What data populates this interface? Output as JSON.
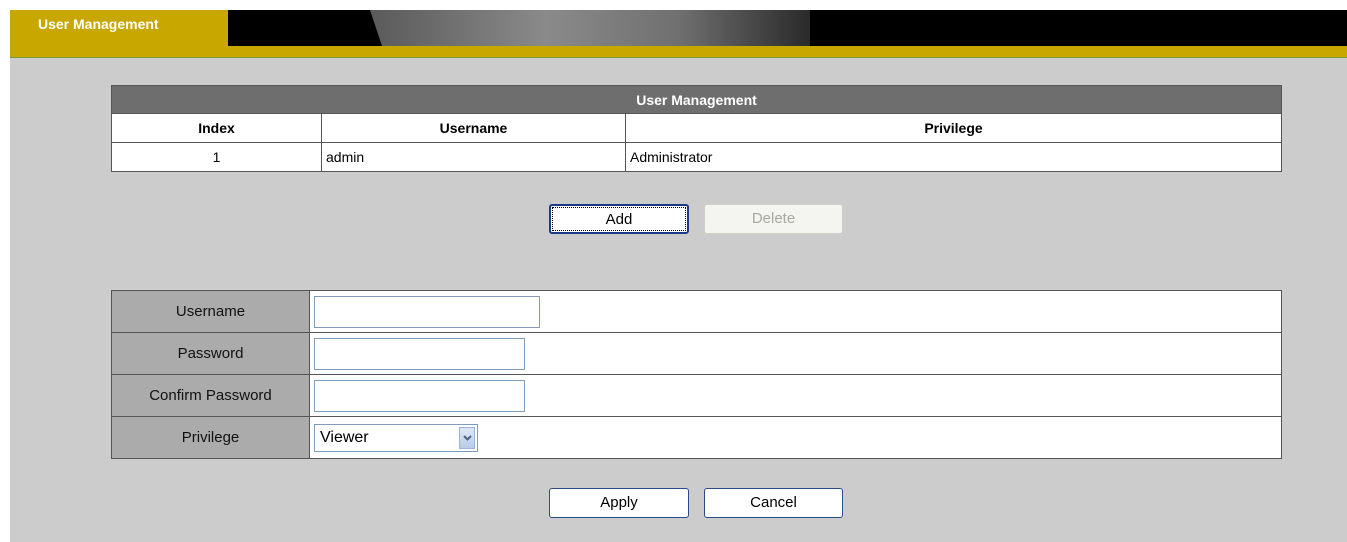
{
  "header": {
    "tab_label": "User Management"
  },
  "user_table": {
    "caption": "User Management",
    "columns": [
      "Index",
      "Username",
      "Privilege"
    ],
    "rows": [
      {
        "index": "1",
        "username": "admin",
        "privilege": "Administrator"
      }
    ]
  },
  "actions": {
    "add_label": "Add",
    "delete_label": "Delete"
  },
  "form": {
    "username_label": "Username",
    "password_label": "Password",
    "confirm_password_label": "Confirm Password",
    "privilege_label": "Privilege",
    "username_value": "",
    "password_value": "",
    "confirm_password_value": "",
    "privilege_selected": "Viewer"
  },
  "footer_actions": {
    "apply_label": "Apply",
    "cancel_label": "Cancel"
  },
  "colors": {
    "accent": "#c8a800",
    "header_bg": "#000000",
    "table_caption_bg": "#6e6e6e",
    "page_bg": "#cccccc",
    "label_bg": "#ababab"
  }
}
